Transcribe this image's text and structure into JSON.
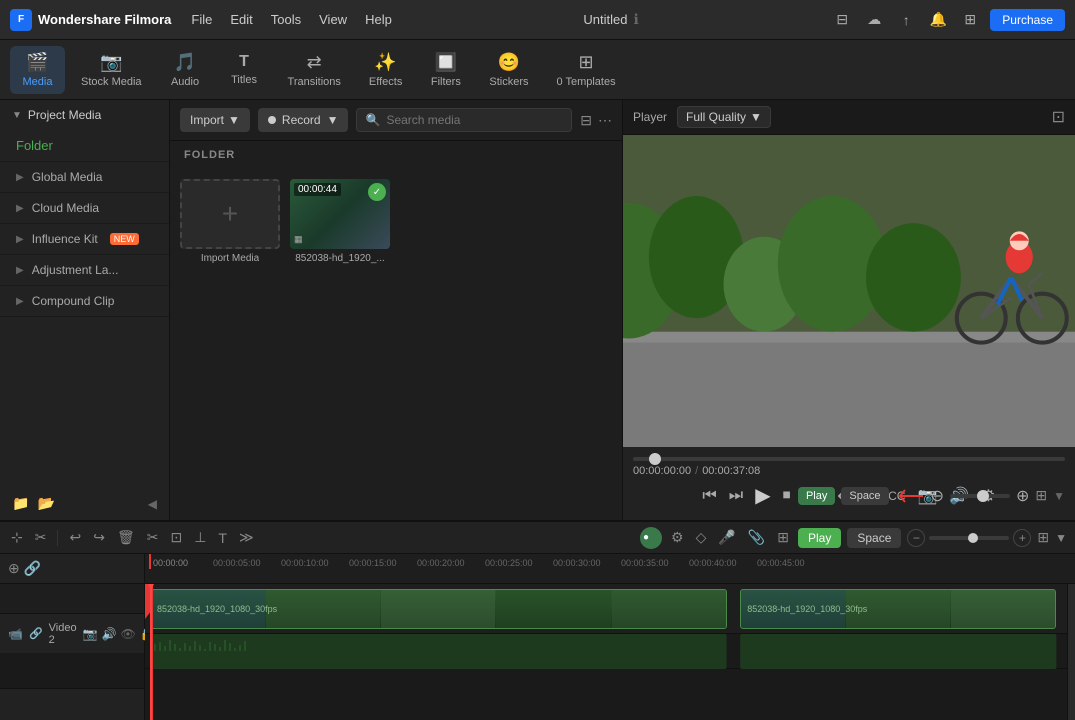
{
  "app": {
    "name": "Wondershare Filmora",
    "logo_letter": "F",
    "title": "Untitled"
  },
  "menu": {
    "items": [
      "File",
      "Edit",
      "Tools",
      "View",
      "Help"
    ]
  },
  "toolbar": {
    "items": [
      {
        "id": "media",
        "label": "Media",
        "icon": "🎬",
        "active": true
      },
      {
        "id": "stock-media",
        "label": "Stock Media",
        "icon": "📷"
      },
      {
        "id": "audio",
        "label": "Audio",
        "icon": "🎵"
      },
      {
        "id": "titles",
        "label": "Titles",
        "icon": "T"
      },
      {
        "id": "transitions",
        "label": "Transitions",
        "icon": "⇄"
      },
      {
        "id": "effects",
        "label": "Effects",
        "icon": "✨"
      },
      {
        "id": "filters",
        "label": "Filters",
        "icon": "🔲"
      },
      {
        "id": "stickers",
        "label": "Stickers",
        "icon": "😊"
      },
      {
        "id": "templates",
        "label": "0 Templates",
        "icon": "⊞"
      }
    ],
    "purchase_label": "Purchase"
  },
  "sidebar": {
    "project_media_label": "Project Media",
    "folder_label": "Folder",
    "items": [
      {
        "label": "Global Media"
      },
      {
        "label": "Cloud Media"
      },
      {
        "label": "Influence Kit",
        "badge": "NEW"
      },
      {
        "label": "Adjustment La..."
      },
      {
        "label": "Compound Clip"
      }
    ]
  },
  "media_panel": {
    "import_label": "Import",
    "record_label": "Record",
    "search_placeholder": "Search media",
    "folder_section": "FOLDER",
    "items": [
      {
        "type": "import",
        "label": "Import Media"
      },
      {
        "type": "clip",
        "label": "852038-hd_1920_...",
        "duration": "00:00:44",
        "checked": true
      }
    ]
  },
  "preview": {
    "player_label": "Player",
    "quality_label": "Full Quality",
    "current_time": "00:00:00:00",
    "total_time": "00:00:37:08",
    "play_label": "Play",
    "space_label": "Space",
    "zoom_minus": "−",
    "zoom_plus": "+"
  },
  "timeline": {
    "toolbar": {
      "play_label": "Play",
      "space_label": "Space",
      "zoom_minus": "−",
      "zoom_plus": "+"
    },
    "ruler": {
      "marks": [
        "00:00:00",
        "00:00:05:00",
        "00:00:10:00",
        "00:00:15:00",
        "00:00:20:00",
        "00:00:25:00",
        "00:00:30:00",
        "00:00:35:00",
        "00:00:40:00",
        "00:00:45:00"
      ]
    },
    "tracks": [
      {
        "label": "Video 2",
        "clips": [
          {
            "label": "852038-hd_1920_1080_30fps",
            "start_pct": 0,
            "width_pct": 62,
            "type": "main"
          },
          {
            "label": "852038-hd_1920_1080_30fps",
            "start_pct": 64,
            "width_pct": 34,
            "type": "main"
          }
        ]
      }
    ]
  }
}
